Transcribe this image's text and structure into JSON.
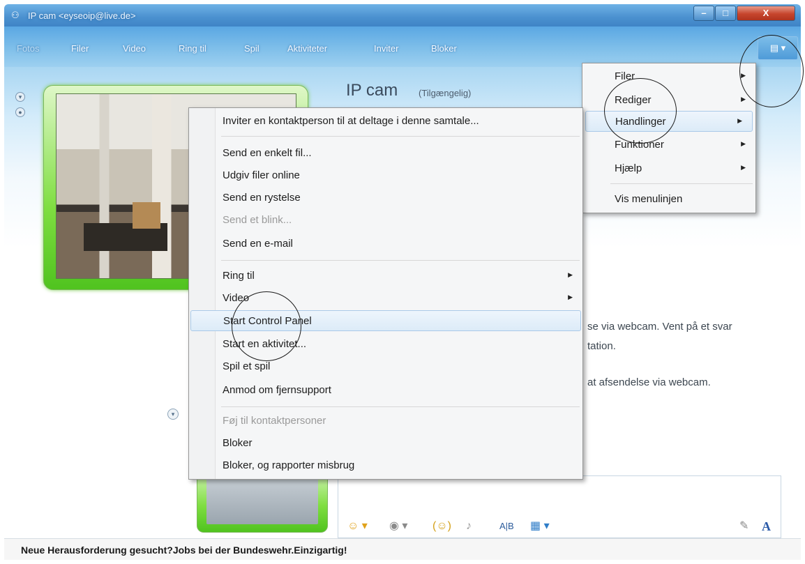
{
  "window": {
    "title": "IP cam <eyseoip@live.de>",
    "controls": {
      "minimize": "–",
      "maximize": "□",
      "close": "X"
    }
  },
  "toolbar": {
    "items": [
      "Fotos",
      "Filer",
      "Video",
      "Ring til",
      "Spil",
      "Aktiviteter",
      "Inviter",
      "Bloker"
    ],
    "layout_button": "▤ ▾"
  },
  "contact": {
    "name": "IP cam",
    "status": "(Tilgængelig)"
  },
  "conversation": {
    "line1a": "se via webcam. Vent på et svar",
    "line1b": "tation.",
    "line2": "at afsendelse via webcam."
  },
  "compose_toolbar": {
    "emoticon": "☺ ▾",
    "wink": "◉ ▾",
    "nudge": "(☺)",
    "voice": "♪",
    "font": "A|B",
    "background": "▦ ▾",
    "handwrite": "✎",
    "text_format": "A"
  },
  "ad": {
    "text": "Neue Herausforderung gesucht?Jobs bei der Bundeswehr.Einzigartig!"
  },
  "context_menu": {
    "items": [
      {
        "label": "Inviter en kontaktperson til at deltage i denne samtale...",
        "disabled": false,
        "submenu": false
      },
      {
        "label": "Send en enkelt fil...",
        "disabled": false,
        "submenu": false
      },
      {
        "label": "Udgiv filer online",
        "disabled": false,
        "submenu": false
      },
      {
        "label": "Send en rystelse",
        "disabled": false,
        "submenu": false
      },
      {
        "label": "Send et blink...",
        "disabled": true,
        "submenu": false
      },
      {
        "label": "Send en e-mail",
        "disabled": false,
        "submenu": false
      },
      {
        "label": "Ring til",
        "disabled": false,
        "submenu": true
      },
      {
        "label": "Video",
        "disabled": false,
        "submenu": true
      },
      {
        "label": "Start Control Panel",
        "disabled": false,
        "submenu": false,
        "highlighted": true
      },
      {
        "label": "Start en aktivitet...",
        "disabled": false,
        "submenu": false
      },
      {
        "label": "Spil et spil",
        "disabled": false,
        "submenu": false
      },
      {
        "label": "Anmod om fjernsupport",
        "disabled": false,
        "submenu": false
      },
      {
        "label": "Føj til kontaktpersoner",
        "disabled": true,
        "submenu": false
      },
      {
        "label": "Bloker",
        "disabled": false,
        "submenu": false
      },
      {
        "label": "Bloker, og rapporter misbrug",
        "disabled": false,
        "submenu": false
      }
    ]
  },
  "main_menu": {
    "items": [
      {
        "label": "Filer",
        "submenu": true
      },
      {
        "label": "Rediger",
        "submenu": true
      },
      {
        "label": "Handlinger",
        "submenu": true,
        "highlighted": true
      },
      {
        "label": "Funktioner",
        "submenu": true
      },
      {
        "label": "Hjælp",
        "submenu": true
      },
      {
        "label": "Vis menulinjen",
        "submenu": false
      }
    ]
  },
  "colors": {
    "title_bar": "#4a90cf",
    "webcam_frame": "#7fde41",
    "menu_highlight": "#dcebf8",
    "close_button": "#c6452d"
  }
}
